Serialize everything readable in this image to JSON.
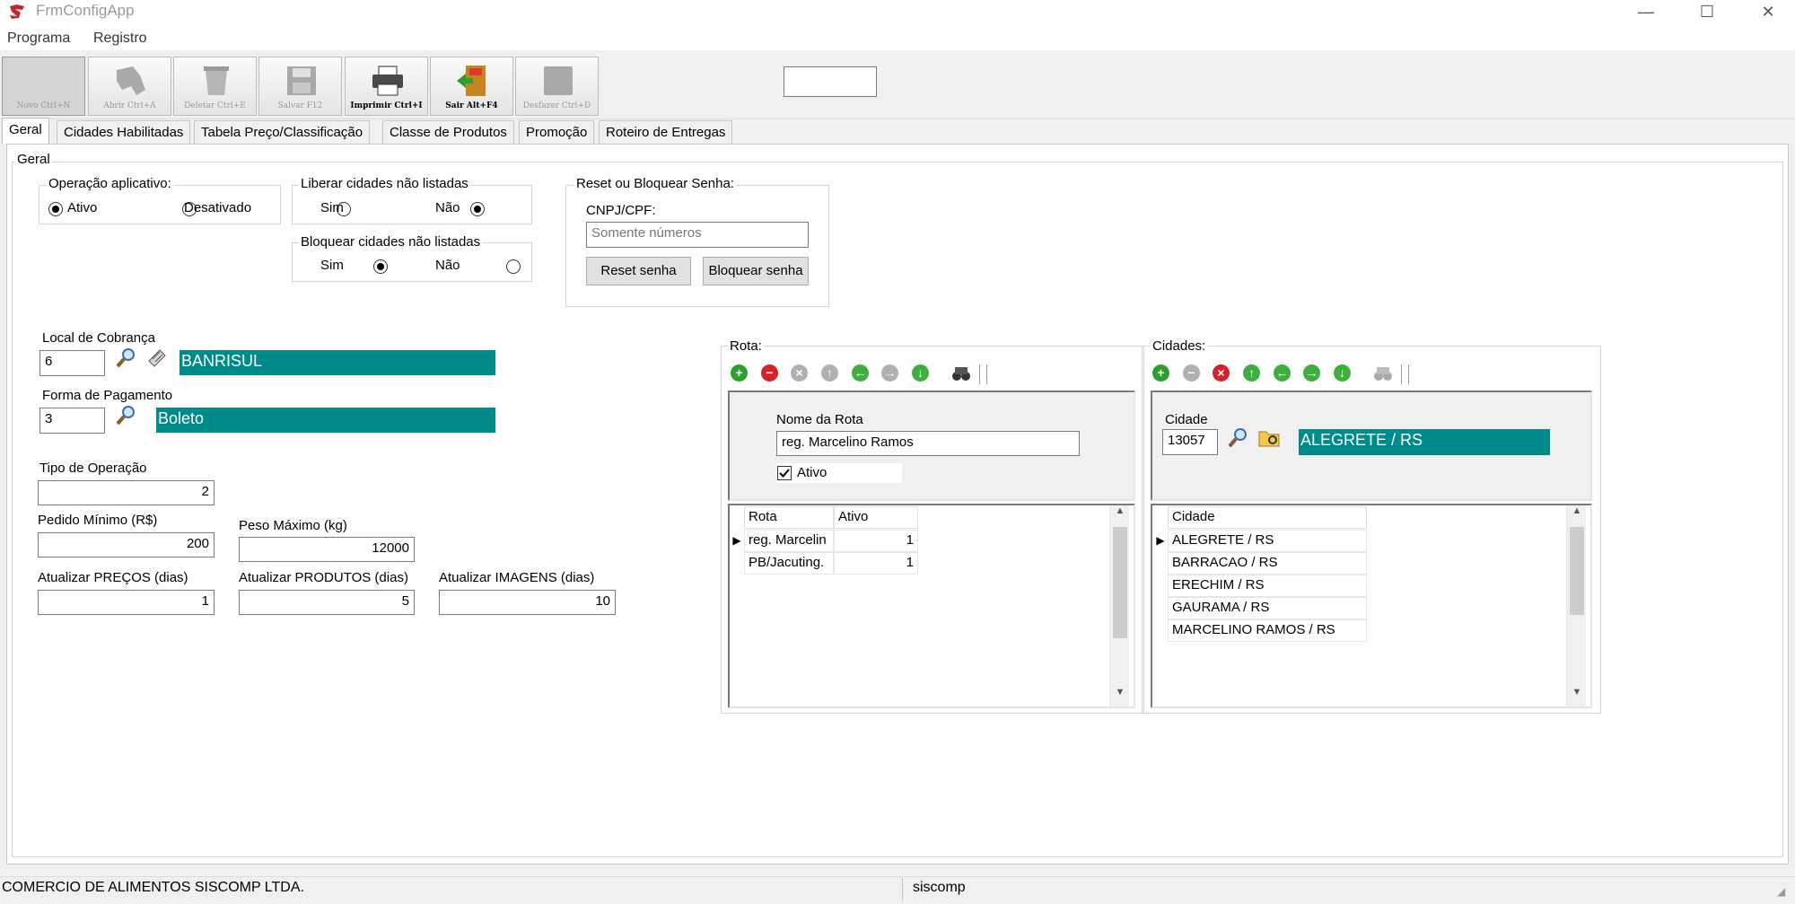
{
  "window": {
    "title": "FrmConfigApp",
    "minimize": "—",
    "maximize": "☐",
    "close": "✕"
  },
  "menu": {
    "items": [
      "Programa",
      "Registro"
    ]
  },
  "toolbar": {
    "buttons": [
      {
        "label": "Novo Ctrl+N",
        "icon": "new-document-icon"
      },
      {
        "label": "Abrir Ctrl+A",
        "icon": "open-icon"
      },
      {
        "label": "Deletar Ctrl+E",
        "icon": "trash-icon"
      },
      {
        "label": "Salvar F12",
        "icon": "save-icon"
      },
      {
        "label": "Imprimir Ctrl+I",
        "icon": "printer-icon"
      },
      {
        "label": "Sair Alt+F4",
        "icon": "exit-door-icon"
      },
      {
        "label": "Desfazer Ctrl+D",
        "icon": "undo-icon"
      }
    ],
    "search_value": ""
  },
  "tabs": [
    "Geral",
    "Cidades Habilitadas",
    "Tabela Preço/Classificação",
    "Classe de Produtos",
    "Promoção",
    "Roteiro de Entregas"
  ],
  "geral": {
    "title": "Geral",
    "operacao": {
      "title": "Operação aplicativo:",
      "options": [
        "Ativo",
        "Desativado"
      ],
      "selected": "Ativo"
    },
    "liberar": {
      "title": "Liberar cidades não listadas",
      "options": [
        "Sim",
        "Não"
      ],
      "selected": "Não"
    },
    "bloquear": {
      "title": "Bloquear cidades não listadas",
      "options": [
        "Sim",
        "Não"
      ],
      "selected": "Sim"
    },
    "reset": {
      "title": "Reset ou Bloquear Senha:",
      "cnpj_label": "CNPJ/CPF:",
      "cnpj_placeholder": "Somente números",
      "reset_button": "Reset senha",
      "block_button": "Bloquear senha"
    },
    "local_cobranca": {
      "label": "Local de Cobrança",
      "code": "6",
      "name": "BANRISUL"
    },
    "forma_pagamento": {
      "label": "Forma de Pagamento",
      "code": "3",
      "name": "Boleto"
    },
    "tipo_operacao": {
      "label": "Tipo de Operação",
      "value": "2"
    },
    "pedido_minimo": {
      "label": "Pedido Mínimo (R$)",
      "value": "200"
    },
    "peso_maximo": {
      "label": "Peso Máximo (kg)",
      "value": "12000"
    },
    "atualizar_precos": {
      "label": "Atualizar PREÇOS (dias)",
      "value": "1"
    },
    "atualizar_produtos": {
      "label": "Atualizar PRODUTOS (dias)",
      "value": "5"
    },
    "atualizar_imagens": {
      "label": "Atualizar IMAGENS (dias)",
      "value": "10"
    },
    "rota": {
      "title": "Rota:",
      "nome_label": "Nome da Rota",
      "nome_value": "reg. Marcelino Ramos",
      "ativo_label": "Ativo",
      "ativo_checked": true,
      "columns": [
        "Rota",
        "Ativo"
      ],
      "rows": [
        {
          "rota": "reg. Marcelin",
          "ativo": "1"
        },
        {
          "rota": "PB/Jacuting.",
          "ativo": "1"
        }
      ]
    },
    "cidades": {
      "title": "Cidades:",
      "cidade_label": "Cidade",
      "cidade_code": "13057",
      "cidade_name": "ALEGRETE / RS",
      "columns": [
        "Cidade"
      ],
      "rows": [
        "ALEGRETE / RS",
        "BARRACAO / RS",
        "ERECHIM / RS",
        "GAURAMA  / RS",
        "MARCELINO RAMOS  / RS"
      ]
    }
  },
  "status": {
    "company": "COMERCIO DE ALIMENTOS SISCOMP LTDA.",
    "user": "siscomp"
  },
  "colors": {
    "teal": "#008b8b",
    "add_green": "#2e9e2e",
    "remove_red": "#d4222a",
    "arrow_green": "#3fae3f"
  }
}
